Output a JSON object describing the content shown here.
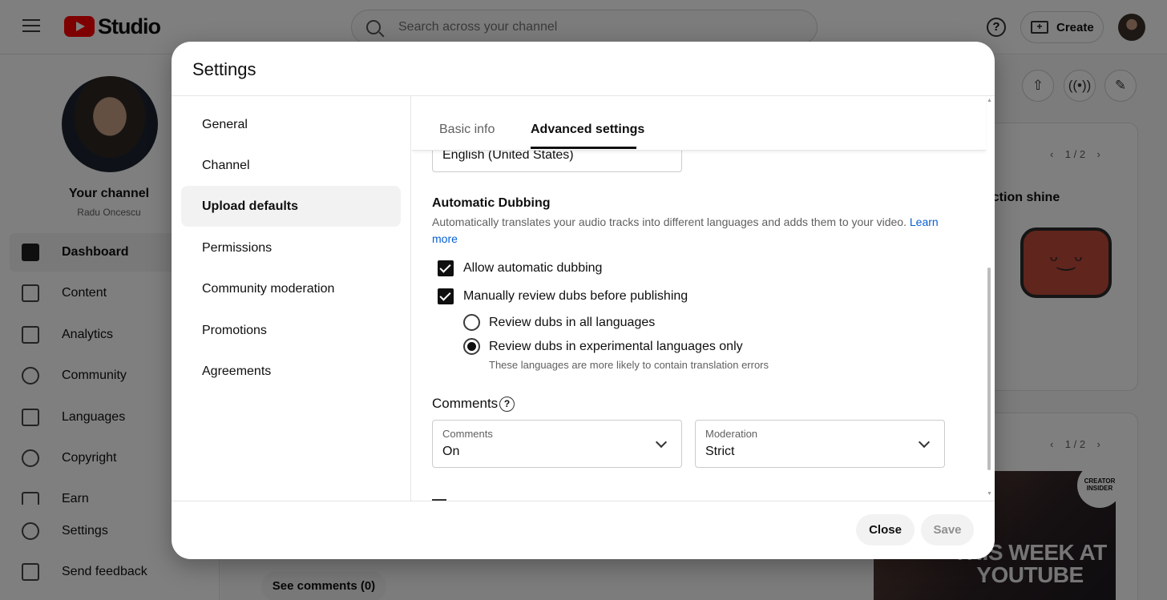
{
  "app": {
    "logo_text": "Studio",
    "search_placeholder": "Search across your channel",
    "create_label": "Create"
  },
  "sidebar": {
    "channel_title": "Your channel",
    "channel_name": "Radu Oncescu",
    "items": [
      {
        "label": "Dashboard",
        "icon": "dashboard-icon",
        "active": true
      },
      {
        "label": "Content",
        "icon": "content-icon"
      },
      {
        "label": "Analytics",
        "icon": "analytics-icon"
      },
      {
        "label": "Community",
        "icon": "community-icon"
      },
      {
        "label": "Languages",
        "icon": "languages-icon"
      },
      {
        "label": "Copyright",
        "icon": "copyright-icon"
      },
      {
        "label": "Earn",
        "icon": "earn-icon"
      },
      {
        "label": "Settings",
        "icon": "gear-icon"
      },
      {
        "label": "Send feedback",
        "icon": "feedback-icon"
      }
    ]
  },
  "background": {
    "pager_1": "1 / 2",
    "pager_2": "1 / 2",
    "card_heading_fragment": "uction shine",
    "thumbnail_text": "THIS WEEK AT YOUTUBE",
    "badge_text": "CREATOR INSIDER",
    "see_comments_label": "See comments (0)"
  },
  "dialog": {
    "title": "Settings",
    "nav": [
      {
        "label": "General"
      },
      {
        "label": "Channel"
      },
      {
        "label": "Upload defaults",
        "active": true
      },
      {
        "label": "Permissions"
      },
      {
        "label": "Community moderation"
      },
      {
        "label": "Promotions"
      },
      {
        "label": "Agreements"
      }
    ],
    "tabs": [
      {
        "label": "Basic info"
      },
      {
        "label": "Advanced settings",
        "active": true
      }
    ],
    "language_value": "English (United States)",
    "dubbing": {
      "heading": "Automatic Dubbing",
      "description": "Automatically translates your audio tracks into different languages and adds them to your video.",
      "learn_more": "Learn more",
      "allow_label": "Allow automatic dubbing",
      "allow_checked": true,
      "review_label": "Manually review dubs before publishing",
      "review_checked": true,
      "radio_all_label": "Review dubs in all languages",
      "radio_experimental_label": "Review dubs in experimental languages only",
      "radio_selected": "experimental",
      "hint": "These languages are more likely to contain translation errors"
    },
    "comments": {
      "heading": "Comments",
      "comments_field_label": "Comments",
      "comments_field_value": "On",
      "moderation_field_label": "Moderation",
      "moderation_field_value": "Strict"
    },
    "buttons": {
      "close": "Close",
      "save": "Save"
    }
  },
  "colors": {
    "brand_red": "#ff0000",
    "link_blue": "#065fd4",
    "scrim": "rgba(0,0,0,0.5)"
  }
}
